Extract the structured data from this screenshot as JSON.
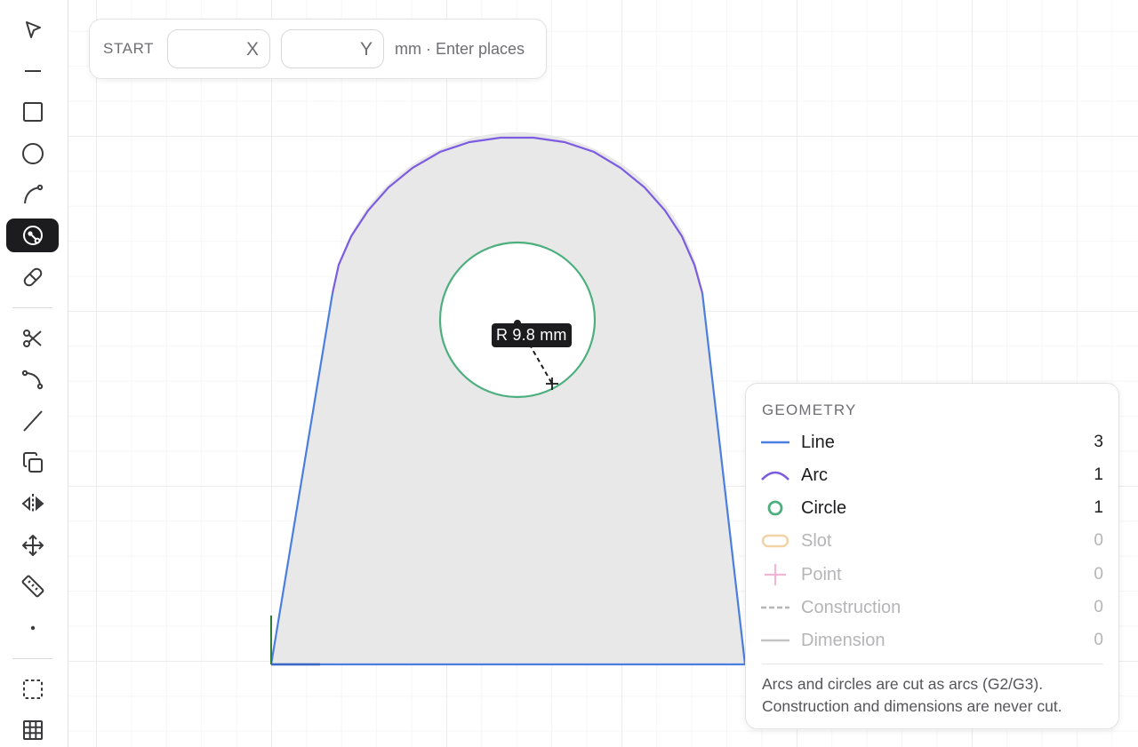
{
  "toolbar": {
    "tools": [
      {
        "name": "select-tool",
        "icon": "pointer-arrow-icon"
      },
      {
        "name": "line-tool",
        "icon": "short-line-icon"
      },
      {
        "name": "rectangle-tool",
        "icon": "square-icon"
      },
      {
        "name": "circle-tool",
        "icon": "circle-icon"
      },
      {
        "name": "arc-tool",
        "icon": "arc-icon"
      },
      {
        "name": "radius-tool",
        "icon": "radius-circle-icon",
        "active": true
      },
      {
        "name": "slot-tool",
        "icon": "slot-icon"
      },
      {
        "name": "trim-tool",
        "icon": "scissors-icon"
      },
      {
        "name": "fillet-tool",
        "icon": "fillet-curve-icon"
      },
      {
        "name": "construction-line-tool",
        "icon": "diagonal-line-icon"
      },
      {
        "name": "copy-tool",
        "icon": "copy-icon"
      },
      {
        "name": "mirror-tool",
        "icon": "mirror-icon"
      },
      {
        "name": "move-tool",
        "icon": "move-arrows-icon"
      },
      {
        "name": "measure-tool",
        "icon": "ruler-icon"
      },
      {
        "name": "point-tool",
        "icon": "dot-icon"
      },
      {
        "name": "selection-box-tool",
        "icon": "dashed-square-icon"
      },
      {
        "name": "grid-toggle-tool",
        "icon": "grid-icon"
      }
    ]
  },
  "start_bar": {
    "label": "START",
    "x_placeholder": "",
    "x_axis": "X",
    "y_placeholder": "",
    "y_axis": "Y",
    "hint": "mm · Enter places"
  },
  "sketch": {
    "radius_label": "R 9.8 mm",
    "colors": {
      "line": "#4a7fe0",
      "arc": "#7c5ce0",
      "circle": "#4caf7d",
      "fill": "#e8e8e9",
      "origin_y": "#2e7d32",
      "origin_x": "#3a66c4"
    }
  },
  "geometry": {
    "title": "GEOMETRY",
    "rows": [
      {
        "label": "Line",
        "count": "3",
        "icon": "line-swatch-icon",
        "muted": false
      },
      {
        "label": "Arc",
        "count": "1",
        "icon": "arc-swatch-icon",
        "muted": false
      },
      {
        "label": "Circle",
        "count": "1",
        "icon": "circle-swatch-icon",
        "muted": false
      },
      {
        "label": "Slot",
        "count": "0",
        "icon": "slot-swatch-icon",
        "muted": true
      },
      {
        "label": "Point",
        "count": "0",
        "icon": "point-swatch-icon",
        "muted": true
      },
      {
        "label": "Construction",
        "count": "0",
        "icon": "construction-swatch-icon",
        "muted": true
      },
      {
        "label": "Dimension",
        "count": "0",
        "icon": "dimension-swatch-icon",
        "muted": true
      }
    ],
    "note": "Arcs and circles are cut as arcs (G2/G3). Construction and dimensions are never cut."
  }
}
